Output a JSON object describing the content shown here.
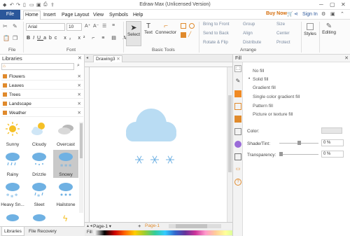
{
  "app": {
    "title": "Edraw Max (Unlicensed Version)"
  },
  "menu": {
    "file": "File",
    "tabs": [
      "Home",
      "Insert",
      "Page Layout",
      "View",
      "Symbols",
      "Help"
    ],
    "buy": "Buy Now",
    "sign_in": "Sign In"
  },
  "ribbon": {
    "font_name": "Arial",
    "font_size": "10",
    "groups": {
      "file": "File",
      "font": "Font",
      "basic_tools": "Basic Tools",
      "arrange": "Arrange"
    },
    "tools": {
      "select": "Select",
      "text": "Text",
      "connector": "Connector"
    },
    "arrange": [
      "Bring to Front",
      "Send to Back",
      "Rotate & Flip",
      "Group",
      "Align",
      "Distribute",
      "Size",
      "Center",
      "Protect"
    ],
    "styles": "Styles",
    "editing": "Editing"
  },
  "libraries": {
    "title": "Libraries",
    "categories": [
      "Flowers",
      "Leaves",
      "Trees",
      "Landscape",
      "Weather"
    ],
    "shapes": [
      "Sunny",
      "Cloudy",
      "Overcast",
      "Rainy",
      "Drizzle",
      "Snowy",
      "Heavy Sn...",
      "Sleet",
      "Hailstone"
    ],
    "bottom_tabs": [
      "Libraries",
      "File Recovery"
    ]
  },
  "canvas": {
    "doc_tab": "Drawing3",
    "page_tab": "Page-1",
    "page_tab2": "Page-1",
    "fill_label": "Fill"
  },
  "fill_panel": {
    "title": "Fill",
    "options": [
      "No fill",
      "Solid fill",
      "Gradient fill",
      "Single color gradient fill",
      "Pattern fill",
      "Picture or texture fill"
    ],
    "color_label": "Color:",
    "shade_label": "Shade/Tint:",
    "shade_value": "0 %",
    "transparency_label": "Transparency:",
    "transparency_value": "0 %"
  },
  "colors": {
    "brand": "#2b579a",
    "cloud": "#b9dcf3",
    "snow": "#6fb1e3",
    "sun": "#f5c026",
    "lib_icon": "#e08a2c"
  }
}
